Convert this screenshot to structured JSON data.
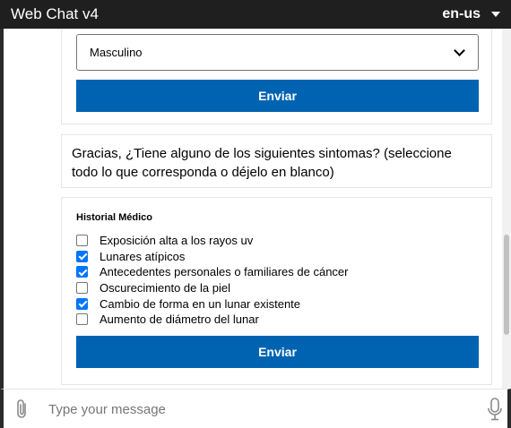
{
  "window": {
    "title": "Web Chat v4",
    "language": "en-us"
  },
  "cards": {
    "gender": {
      "selected_value": "Masculino",
      "submit_label": "Enviar"
    },
    "message": {
      "text": "Gracias, ¿Tiene alguno de los siguientes sintomas? (seleccione todo lo que corresponda o déjelo en blanco)"
    },
    "history": {
      "title": "Historial Médico",
      "options": [
        {
          "label": "Exposición alta a los rayos uv",
          "checked": false
        },
        {
          "label": "Lunares atípicos",
          "checked": true
        },
        {
          "label": "Antecedentes personales o familiares de cáncer",
          "checked": true
        },
        {
          "label": "Oscurecimiento de la piel",
          "checked": false
        },
        {
          "label": "Cambio de forma en un lunar existente",
          "checked": true
        },
        {
          "label": "Aumento de diámetro del lunar",
          "checked": false
        }
      ],
      "submit_label": "Enviar"
    }
  },
  "sendbox": {
    "placeholder": "Type your message",
    "attach_icon": "paperclip-icon",
    "mic_icon": "microphone-icon"
  },
  "colors": {
    "titlebar_bg": "#1f1f1f",
    "button_bg": "#0063b1",
    "checkbox_checked": "#0075ff"
  }
}
